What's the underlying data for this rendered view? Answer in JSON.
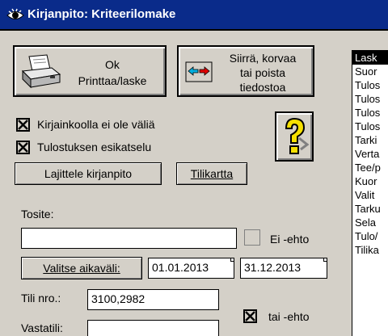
{
  "window": {
    "title": "Kirjanpito: Kriteerilomake",
    "icon": "eye-icon"
  },
  "buttons": {
    "ok_line1": "Ok",
    "ok_line2": "Printtaa/laske",
    "move_line1": "Siirrä, korvaa",
    "move_line2": "tai poista",
    "move_line3": "tiedostoa",
    "sort": "Lajittele kirjanpito",
    "accounts": "Tilikartta",
    "help": "help-icon"
  },
  "checkboxes": {
    "case_insensitive": {
      "label": "Kirjainkoolla ei ole väliä",
      "checked": true
    },
    "print_preview": {
      "label": "Tulostuksen esikatselu",
      "checked": true
    },
    "or_condition": {
      "label": "tai -ehto",
      "checked": true
    },
    "not_condition": {
      "label": "Ei -ehto",
      "checked": false
    }
  },
  "fields": {
    "voucher_label": "Tosite:",
    "voucher_value": "",
    "period_button": "Valitse aikaväli:",
    "date_start": "01.01.2013",
    "date_end": "31.12.2013",
    "account_label": "Tili nro.:",
    "account_value": "3100,2982",
    "counter_account_label": "Vastatili:",
    "counter_account_value": ""
  },
  "list": {
    "items": [
      "Lask",
      "Suor",
      "Tulos",
      "Tulos",
      "Tulos",
      "Tulos",
      "Tarki",
      "Verta",
      "Tee/p",
      "Kuor",
      "Valit",
      "Tarku",
      "Sela",
      "Tulo/",
      "Tilika"
    ],
    "selected_index": 0
  },
  "colors": {
    "titlebar": "#0a2b8a",
    "window_bg": "#d4d0c8"
  }
}
